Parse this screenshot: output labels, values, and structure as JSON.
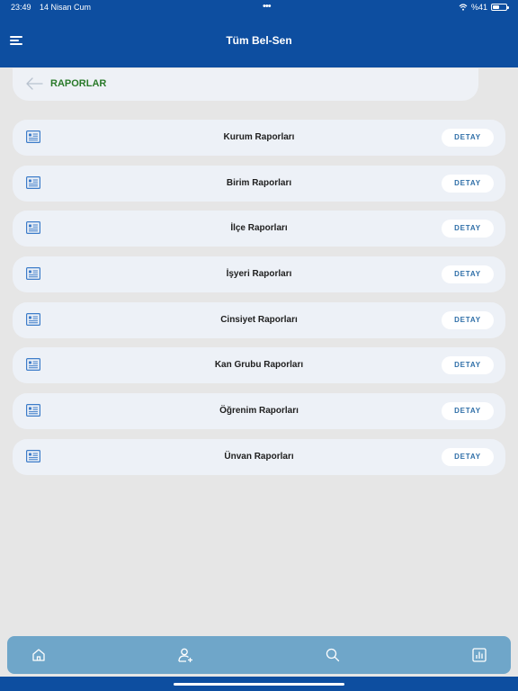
{
  "status_bar": {
    "time": "23:49",
    "date": "14 Nisan Cum",
    "battery": "%41",
    "wifi_icon": "wifi-icon",
    "battery_icon": "battery-icon"
  },
  "header": {
    "title": "Tüm Bel-Sen",
    "menu_icon": "hamburger-menu-icon"
  },
  "section": {
    "title": "RAPORLAR",
    "back_icon": "arrow-left-icon"
  },
  "reports": [
    {
      "label": "Kurum Raporları",
      "action": "DETAY",
      "icon": "report-icon"
    },
    {
      "label": "Birim Raporları",
      "action": "DETAY",
      "icon": "report-icon"
    },
    {
      "label": "İlçe Raporları",
      "action": "DETAY",
      "icon": "report-icon"
    },
    {
      "label": "İşyeri Raporları",
      "action": "DETAY",
      "icon": "report-icon"
    },
    {
      "label": "Cinsiyet Raporları",
      "action": "DETAY",
      "icon": "report-icon"
    },
    {
      "label": "Kan Grubu Raporları",
      "action": "DETAY",
      "icon": "report-icon"
    },
    {
      "label": "Öğrenim Raporları",
      "action": "DETAY",
      "icon": "report-icon"
    },
    {
      "label": "Ünvan Raporları",
      "action": "DETAY",
      "icon": "report-icon"
    }
  ],
  "bottom_nav": [
    "home-icon",
    "add-user-icon",
    "search-icon",
    "chart-icon"
  ],
  "colors": {
    "primary": "#0d4ea0",
    "accent_green": "#2a7a2a",
    "nav_bar": "#6fa6c9",
    "detail_text": "#2f6fa8",
    "background": "#e6e6e6"
  }
}
